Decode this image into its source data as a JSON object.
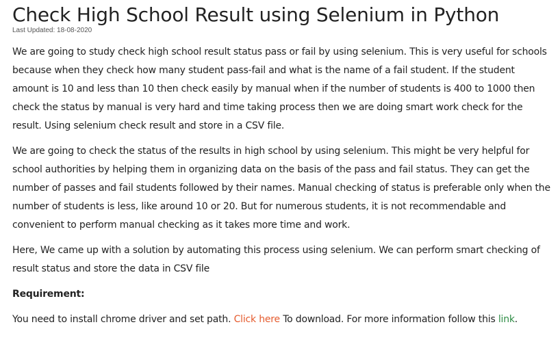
{
  "article": {
    "title": "Check High School Result using Selenium in Python",
    "last_updated": "Last Updated: 18-08-2020",
    "paragraphs": [
      "We are going to study check high school result status pass or fail by using selenium. This is very useful for schools because when they check how many student pass-fail and what is the name of a fail student. If the student amount is 10 and less than 10 then check easily by manual when if the number of students is 400 to 1000 then check the status by manual is very hard and time taking process then we are doing smart work check for the result. Using selenium check result and store in a CSV file.",
      "We are going to check the status of the results in high school by using selenium. This might be very helpful for school authorities by helping them in organizing data on the basis of the pass and fail status. They can get the number of passes and fail students followed by their names. Manual checking of status is preferable only when the number of students is less, like around 10 or 20. But for numerous students, it is not recommendable and convenient to perform manual checking as it takes more time and work.",
      "Here, We came up with a solution by automating this process using selenium. We can perform smart checking of result status and store the data in CSV file"
    ],
    "requirement_heading": "Requirement:",
    "install": {
      "text_before": "You need to install chrome driver and set path. ",
      "click_here": "Click here",
      "text_middle": " To download. For more information follow this ",
      "link": "link",
      "text_after": "."
    },
    "colors": {
      "text": "#222222",
      "link_orange": "#e55b2e",
      "link_green": "#2f8d46"
    }
  }
}
